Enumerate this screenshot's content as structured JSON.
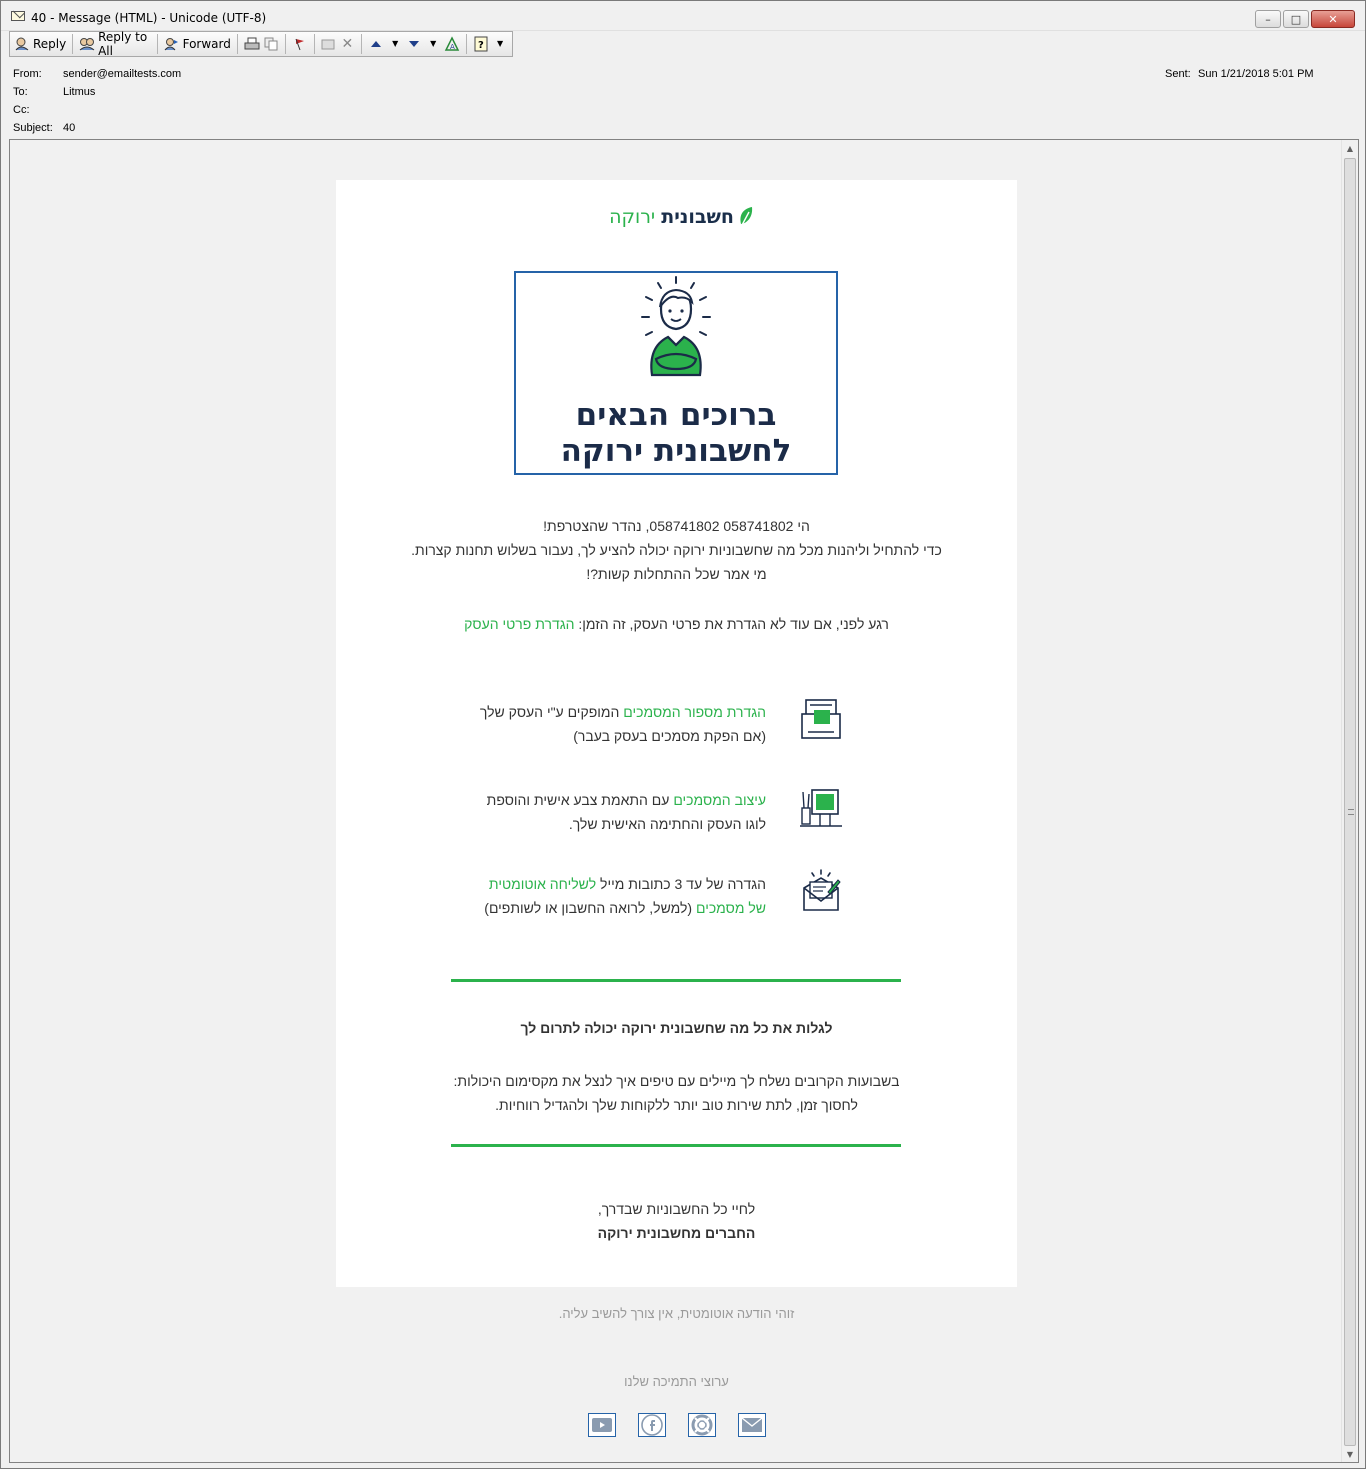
{
  "window": {
    "title": "40 - Message (HTML)  - Unicode (UTF-8)"
  },
  "toolbar": {
    "reply": "Reply",
    "reply_all": "Reply to All",
    "forward": "Forward"
  },
  "headers": {
    "from_label": "From:",
    "from_value": "sender@emailtests.com",
    "to_label": "To:",
    "to_value": "Litmus",
    "cc_label": "Cc:",
    "cc_value": "",
    "subject_label": "Subject:",
    "subject_value": "40",
    "sent_label": "Sent:",
    "sent_value": "Sun 1/21/2018 5:01 PM"
  },
  "email": {
    "logo_bold": "חשבונית",
    "logo_light": "ירוקה",
    "hero_line1": "ברוכים הבאים",
    "hero_line2": "לחשבונית ירוקה",
    "intro_line1": "הי 058741802 058741802, נהדר שהצטרפת!",
    "intro_line2": "כדי להתחיל וליהנות מכל מה שחשבוניות ירוקה יכולה להציע לך, נעבור בשלוש תחנות קצרות.",
    "intro_line3": "מי אמר שכל ההתחלות קשות?!",
    "setup_text": "רגע לפני, אם עוד לא הגדרת את פרטי העסק, זה הזמן: ",
    "setup_link": "הגדרת פרטי העסק",
    "features": [
      {
        "icon": "document-numbers-icon",
        "link": "הגדרת מספור המסמכים",
        "text1": " המופקים ע\"י העסק שלך",
        "text2": "(אם הפקת מסמכים בעסק בעבר)"
      },
      {
        "icon": "design-desk-icon",
        "link": "עיצוב המסמכים",
        "text1": " עם התאמת צבע אישית והוספת",
        "text2": "לוגו העסק והחתימה האישית שלך."
      },
      {
        "icon": "email-envelope-icon",
        "text_pre": "הגדרה של עד 3 כתובות מייל ",
        "link1": "לשליחה אוטומטית",
        "link2": "של מסמכים",
        "text2": " (למשל, לרואה החשבון או לשותפים)"
      }
    ],
    "discover_title": "לגלות את כל מה שחשבונית ירוקה יכולה לתרום לך",
    "discover_line1": "בשבועות הקרובים נשלח לך מיילים עם טיפים איך לנצל את מקסימום היכולות:",
    "discover_line2": "לחסוך זמן, לתת שירות טוב יותר ללקוחות שלך ולהגדיל רווחיות.",
    "signoff_line1": "לחיי כל החשבוניות שבדרך,",
    "signoff_line2": "החברים מחשבונית ירוקה"
  },
  "footer": {
    "auto_note": "זוהי הודעה אוטומטית, אין צורך להשיב עליה.",
    "support_title": "ערוצי התמיכה שלנו",
    "social": [
      "youtube-icon",
      "facebook-icon",
      "support-lifebuoy-icon",
      "mail-icon"
    ]
  },
  "colors": {
    "brand_green": "#2bb24c",
    "brand_navy": "#1b2b48",
    "frame_blue": "#2563a8"
  }
}
